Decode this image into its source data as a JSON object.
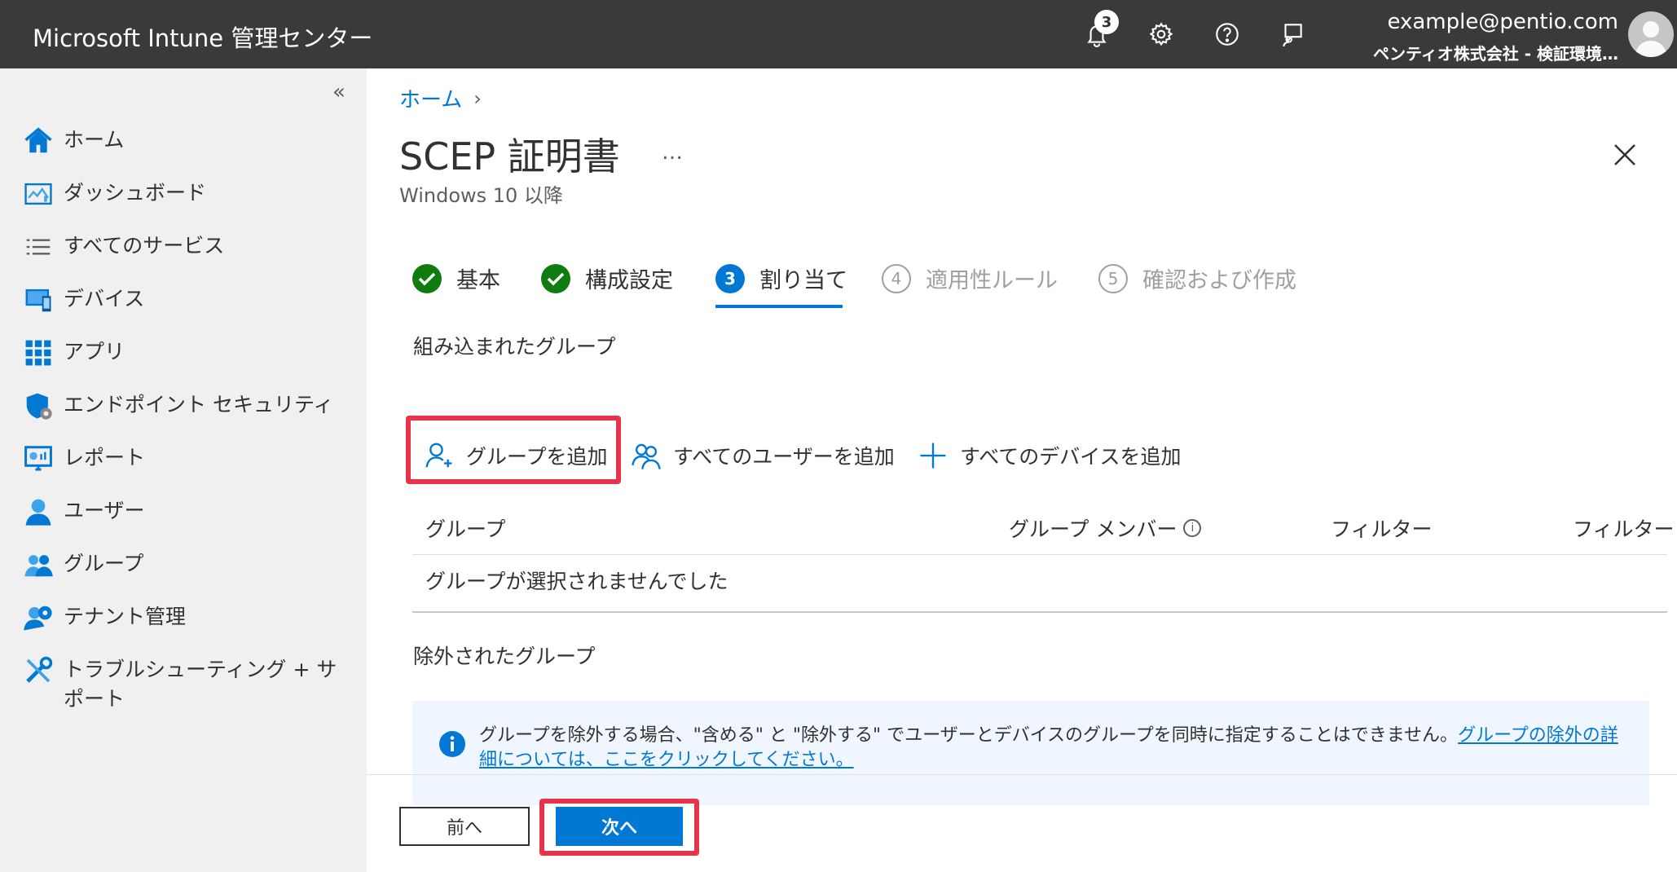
{
  "header": {
    "app_title": "Microsoft Intune 管理センター",
    "notification_count": "3",
    "account_email": "example@pentio.com",
    "account_tenant": "ペンティオ株式会社 - 検証環境…"
  },
  "sidebar": {
    "collapse": "«",
    "items": [
      {
        "label": "ホーム",
        "icon": "home-icon"
      },
      {
        "label": "ダッシュボード",
        "icon": "dashboard-icon"
      },
      {
        "label": "すべてのサービス",
        "icon": "list-icon"
      },
      {
        "label": "デバイス",
        "icon": "device-icon"
      },
      {
        "label": "アプリ",
        "icon": "apps-grid-icon"
      },
      {
        "label": "エンドポイント セキュリティ",
        "icon": "shield-icon"
      },
      {
        "label": "レポート",
        "icon": "report-icon"
      },
      {
        "label": "ユーザー",
        "icon": "user-icon"
      },
      {
        "label": "グループ",
        "icon": "group-icon"
      },
      {
        "label": "テナント管理",
        "icon": "tenant-gear-icon"
      },
      {
        "label": "トラブルシューティング + サポート",
        "icon": "tools-icon"
      }
    ]
  },
  "main": {
    "breadcrumb": "ホーム",
    "title": "SCEP 証明書",
    "more": "…",
    "subtitle": "Windows 10 以降",
    "steps": [
      {
        "num": "",
        "label": "基本",
        "state": "done"
      },
      {
        "num": "",
        "label": "構成設定",
        "state": "done"
      },
      {
        "num": "3",
        "label": "割り当て",
        "state": "current"
      },
      {
        "num": "4",
        "label": "適用性ルール",
        "state": "pending"
      },
      {
        "num": "5",
        "label": "確認および作成",
        "state": "pending"
      }
    ],
    "included_title": "組み込まれたグループ",
    "commands": {
      "add_group": "グループを追加",
      "add_all_users": "すべてのユーザーを追加",
      "add_all_devices": "すべてのデバイスを追加"
    },
    "table": {
      "columns": [
        "グループ",
        "グループ メンバー",
        "フィルター",
        "フィルター"
      ],
      "info_glyph": "i",
      "empty_text": "グループが選択されませんでした"
    },
    "excluded_title": "除外されたグループ",
    "info_message": "グループを除外する場合、\"含める\" と \"除外する\" でユーザーとデバイスのグループを同時に指定することはできません。",
    "info_link": "グループの除外の詳細については、ここをクリックしてください。"
  },
  "footer": {
    "prev_label": "前へ",
    "next_label": "次へ"
  },
  "colors": {
    "accent": "#0078d4",
    "highlight": "#e8344a",
    "done": "#107c10"
  }
}
